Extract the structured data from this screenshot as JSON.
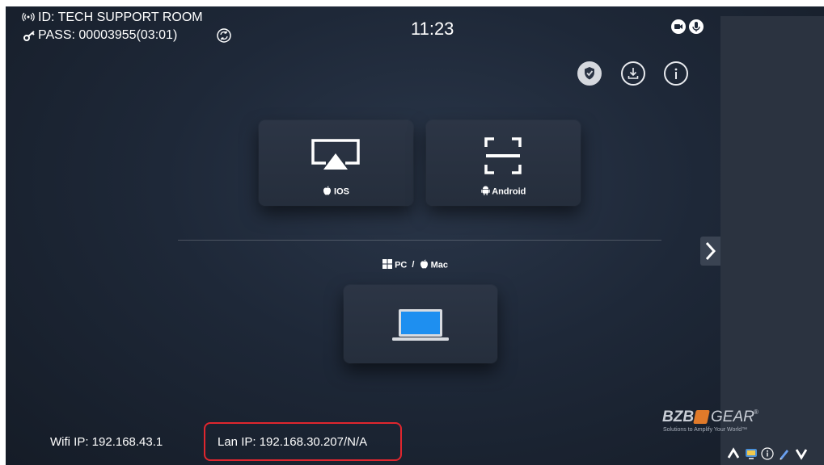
{
  "header": {
    "room_id": "ID: TECH SUPPORT ROOM",
    "password": "PASS: 00003955(03:01)",
    "clock": "11:23"
  },
  "toolbar_icons": [
    "video-record-icon",
    "microphone-icon",
    "shield-icon",
    "download-icon",
    "info-icon"
  ],
  "cast_options": {
    "ios_label": "IOS",
    "android_label": "Android",
    "pc_mac_label_pc": "PC",
    "pc_mac_separator": "/",
    "pc_mac_label_mac": "Mac"
  },
  "footer": {
    "wifi_ip": "Wifi IP: 192.168.43.1",
    "lan_ip": "Lan IP: 192.168.30.207/N/A"
  },
  "brand": {
    "logo_text_left": "BZB",
    "logo_text_right": "GEAR",
    "registered": "®",
    "tagline": "Solutions to Amplify Your World™"
  },
  "colors": {
    "highlight_box": "#e0262e",
    "accent_blue": "#1e8ff0",
    "brand_orange": "#e07a2a"
  }
}
